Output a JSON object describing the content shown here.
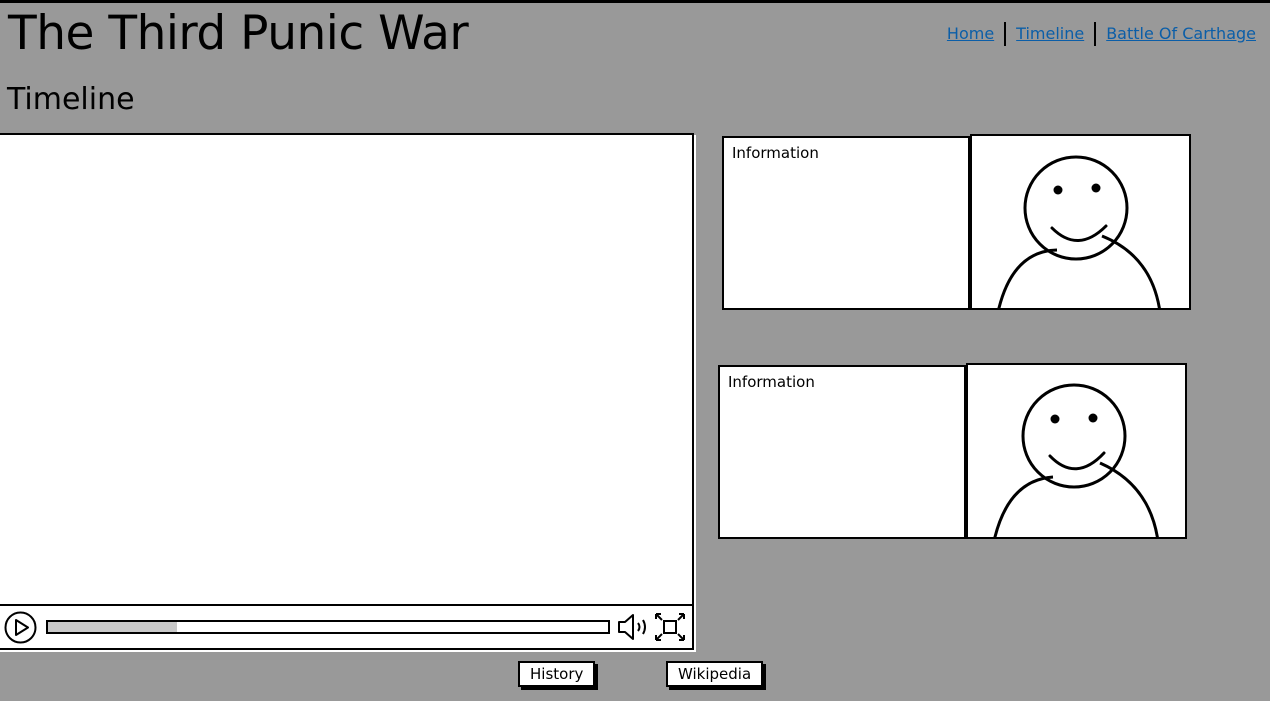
{
  "header": {
    "site_title": "The Third Punic War",
    "nav": [
      "Home",
      "Timeline",
      "Battle Of Carthage"
    ]
  },
  "page": {
    "heading": "Timeline"
  },
  "video": {
    "progress": 0.23
  },
  "info_cards": [
    {
      "text": "Information"
    },
    {
      "text": "Information"
    }
  ],
  "footer_buttons": [
    "History",
    "Wikipedia"
  ],
  "colors": {
    "background": "#999999",
    "link": "#0b5ea8"
  },
  "icons": [
    "play-icon",
    "volume-icon",
    "fullscreen-icon",
    "person-avatar-icon"
  ]
}
